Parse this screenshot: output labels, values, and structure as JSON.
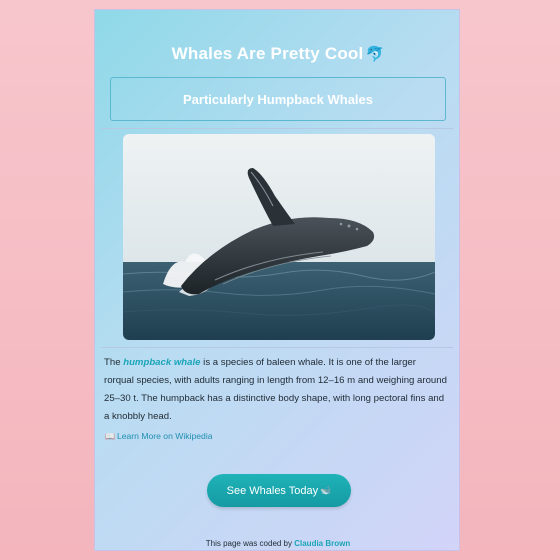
{
  "page": {
    "title": "Whales Are Pretty Cool",
    "title_emoji": "🐬",
    "subtitle": "Particularly Humpback Whales",
    "image_alt": "Humpback whale breaching",
    "description": {
      "prefix": "The ",
      "link_text": "humpback whale",
      "body": " is a species of baleen whale. It is one of the larger rorqual species, with adults ranging in length from 12–16 m and weighing around 25–30 t. The humpback has a distinctive body shape, with long pectoral fins and a knobbly head."
    },
    "wiki_icon": "📖",
    "wiki_link": "Learn More on Wikipedia",
    "cta_label": "See Whales Today",
    "cta_emoji": "🐋",
    "footer": {
      "prefix": "This page was coded by ",
      "author": "Claudia Brown"
    }
  },
  "colors": {
    "background": "#f4b5bd",
    "accent": "#1aa5b8",
    "button": "#159aa3"
  }
}
